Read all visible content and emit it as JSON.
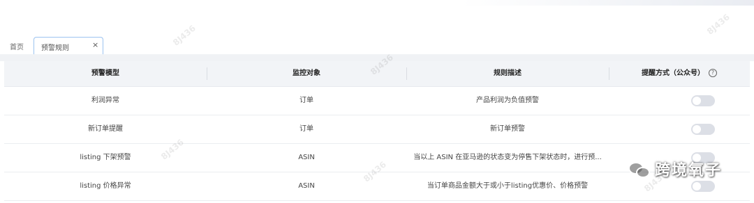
{
  "tabs": {
    "home_label": "首页",
    "active_label": "预警规则",
    "close_glyph": "×"
  },
  "table": {
    "headers": [
      "预警模型",
      "监控对象",
      "规则描述",
      "提醒方式（公众号）"
    ],
    "rows": [
      {
        "model": "利润异常",
        "target": "订单",
        "description": "产品利润为负值预警",
        "notify_enabled": false
      },
      {
        "model": "新订单提醒",
        "target": "订单",
        "description": "新订单预警",
        "notify_enabled": false
      },
      {
        "model": "listing 下架预警",
        "target": "ASIN",
        "description": "当以上 ASIN 在亚马逊的状态变为停售下架状态时，进行预...",
        "notify_enabled": false
      },
      {
        "model": "listing 价格异常",
        "target": "ASIN",
        "description": "当订单商品金额大于或小于listing优惠价、价格预警",
        "notify_enabled": false
      }
    ]
  },
  "help_glyph": "?",
  "watermark": {
    "text": "8J436"
  },
  "brand_overlay": {
    "icon": "wechat-icon",
    "text": "跨境氧子"
  },
  "colors": {
    "tab_border": "#9cc3f0",
    "toggle_off": "#dcdfe6",
    "header_bg": "#f2f4f7"
  }
}
